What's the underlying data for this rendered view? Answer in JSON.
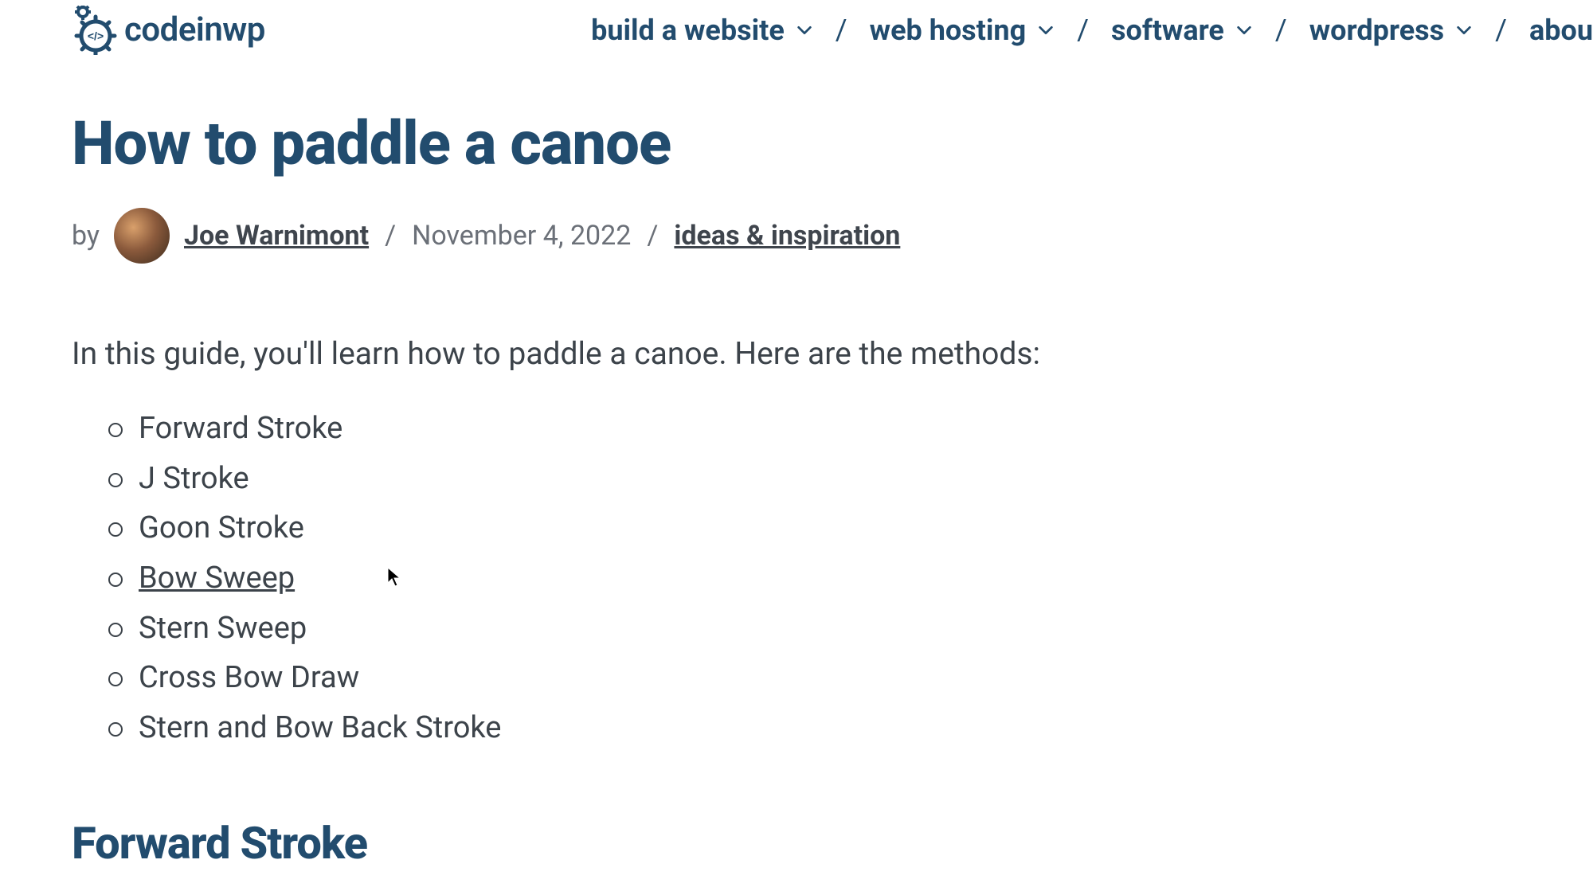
{
  "brand": {
    "name": "codeinwp"
  },
  "nav": {
    "items": [
      {
        "label": "build a website"
      },
      {
        "label": "web hosting"
      },
      {
        "label": "software"
      },
      {
        "label": "wordpress"
      },
      {
        "label": "abou"
      }
    ],
    "separator": "/"
  },
  "article": {
    "title": "How to paddle a canoe",
    "byline_prefix": "by",
    "author": "Joe Warnimont",
    "date": "November 4, 2022",
    "category": "ideas & inspiration",
    "intro": "In this guide, you'll learn how to paddle a canoe. Here are the methods:",
    "methods": [
      {
        "label": "Forward Stroke",
        "link": false
      },
      {
        "label": "J Stroke",
        "link": false
      },
      {
        "label": "Goon Stroke",
        "link": false
      },
      {
        "label": "Bow Sweep",
        "link": true
      },
      {
        "label": "Stern Sweep",
        "link": false
      },
      {
        "label": "Cross Bow Draw",
        "link": false
      },
      {
        "label": "Stern and Bow Back Stroke",
        "link": false
      }
    ],
    "first_section_heading": "Forward Stroke"
  }
}
